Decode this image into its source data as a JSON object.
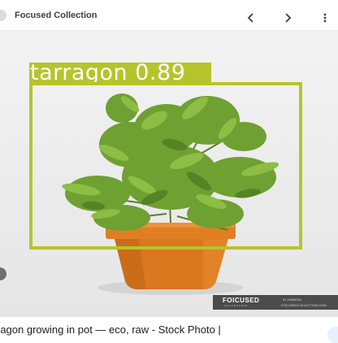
{
  "header": {
    "title": "Focused Collection",
    "icons": {
      "prev": "chevron-left-icon",
      "next": "chevron-right-icon",
      "menu": "more-vert-icon"
    }
  },
  "detection": {
    "label": "tarragon 0.89",
    "color": "#b6c42b"
  },
  "watermark": {
    "logo": "FOICUSED",
    "sub": "COLLECTION",
    "id": "ID 14806264",
    "site": "FOCUSEDCOLLECTION.COM"
  },
  "caption": {
    "text": "ragon growing in pot — eco, raw - Stock Photo |"
  },
  "colors": {
    "pot": "#d9781e",
    "leaf": "#6fa032",
    "background": "#ececec"
  }
}
